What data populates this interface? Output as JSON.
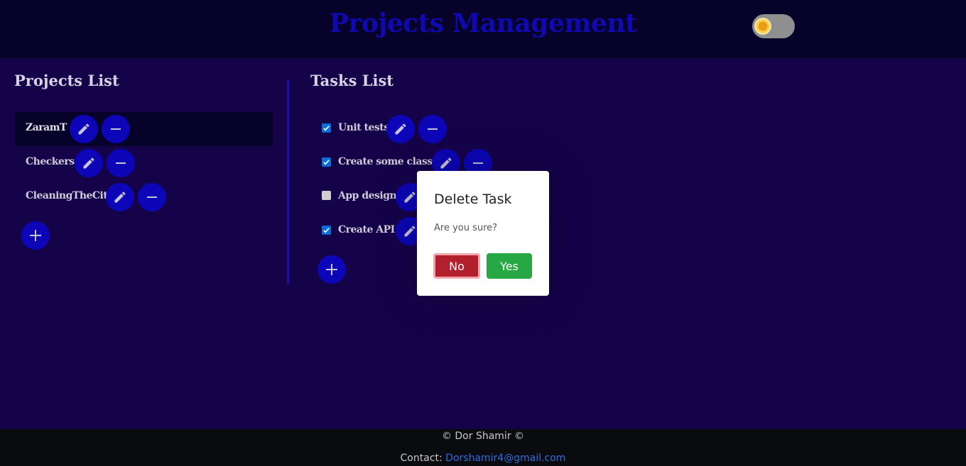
{
  "header": {
    "title": "Projects Management"
  },
  "projects": {
    "title": "Projects List",
    "items": [
      {
        "label": "ZaramT"
      },
      {
        "label": "Checkers"
      },
      {
        "label": "CleaningTheCity"
      }
    ]
  },
  "tasks": {
    "title": "Tasks List",
    "items": [
      {
        "label": "Unit tests",
        "checked": true
      },
      {
        "label": "Create some classes",
        "checked": true
      },
      {
        "label": "App design",
        "checked": false
      },
      {
        "label": "Create API",
        "checked": true
      }
    ]
  },
  "dialog": {
    "title": "Delete Task",
    "message": "Are you sure?",
    "no_label": "No",
    "yes_label": "Yes"
  },
  "footer": {
    "copyright": "© Dor Shamir ©",
    "contact_label": "Contact:",
    "email": "Dorshamir4@gmail.com"
  },
  "icons": {
    "edit": "pencil-icon",
    "remove": "minus-icon",
    "add": "plus-icon",
    "theme": "sun-icon"
  },
  "colors": {
    "accent": "#0c06b8",
    "background": "#15034a",
    "danger": "#b21f2d",
    "success": "#28a745"
  }
}
